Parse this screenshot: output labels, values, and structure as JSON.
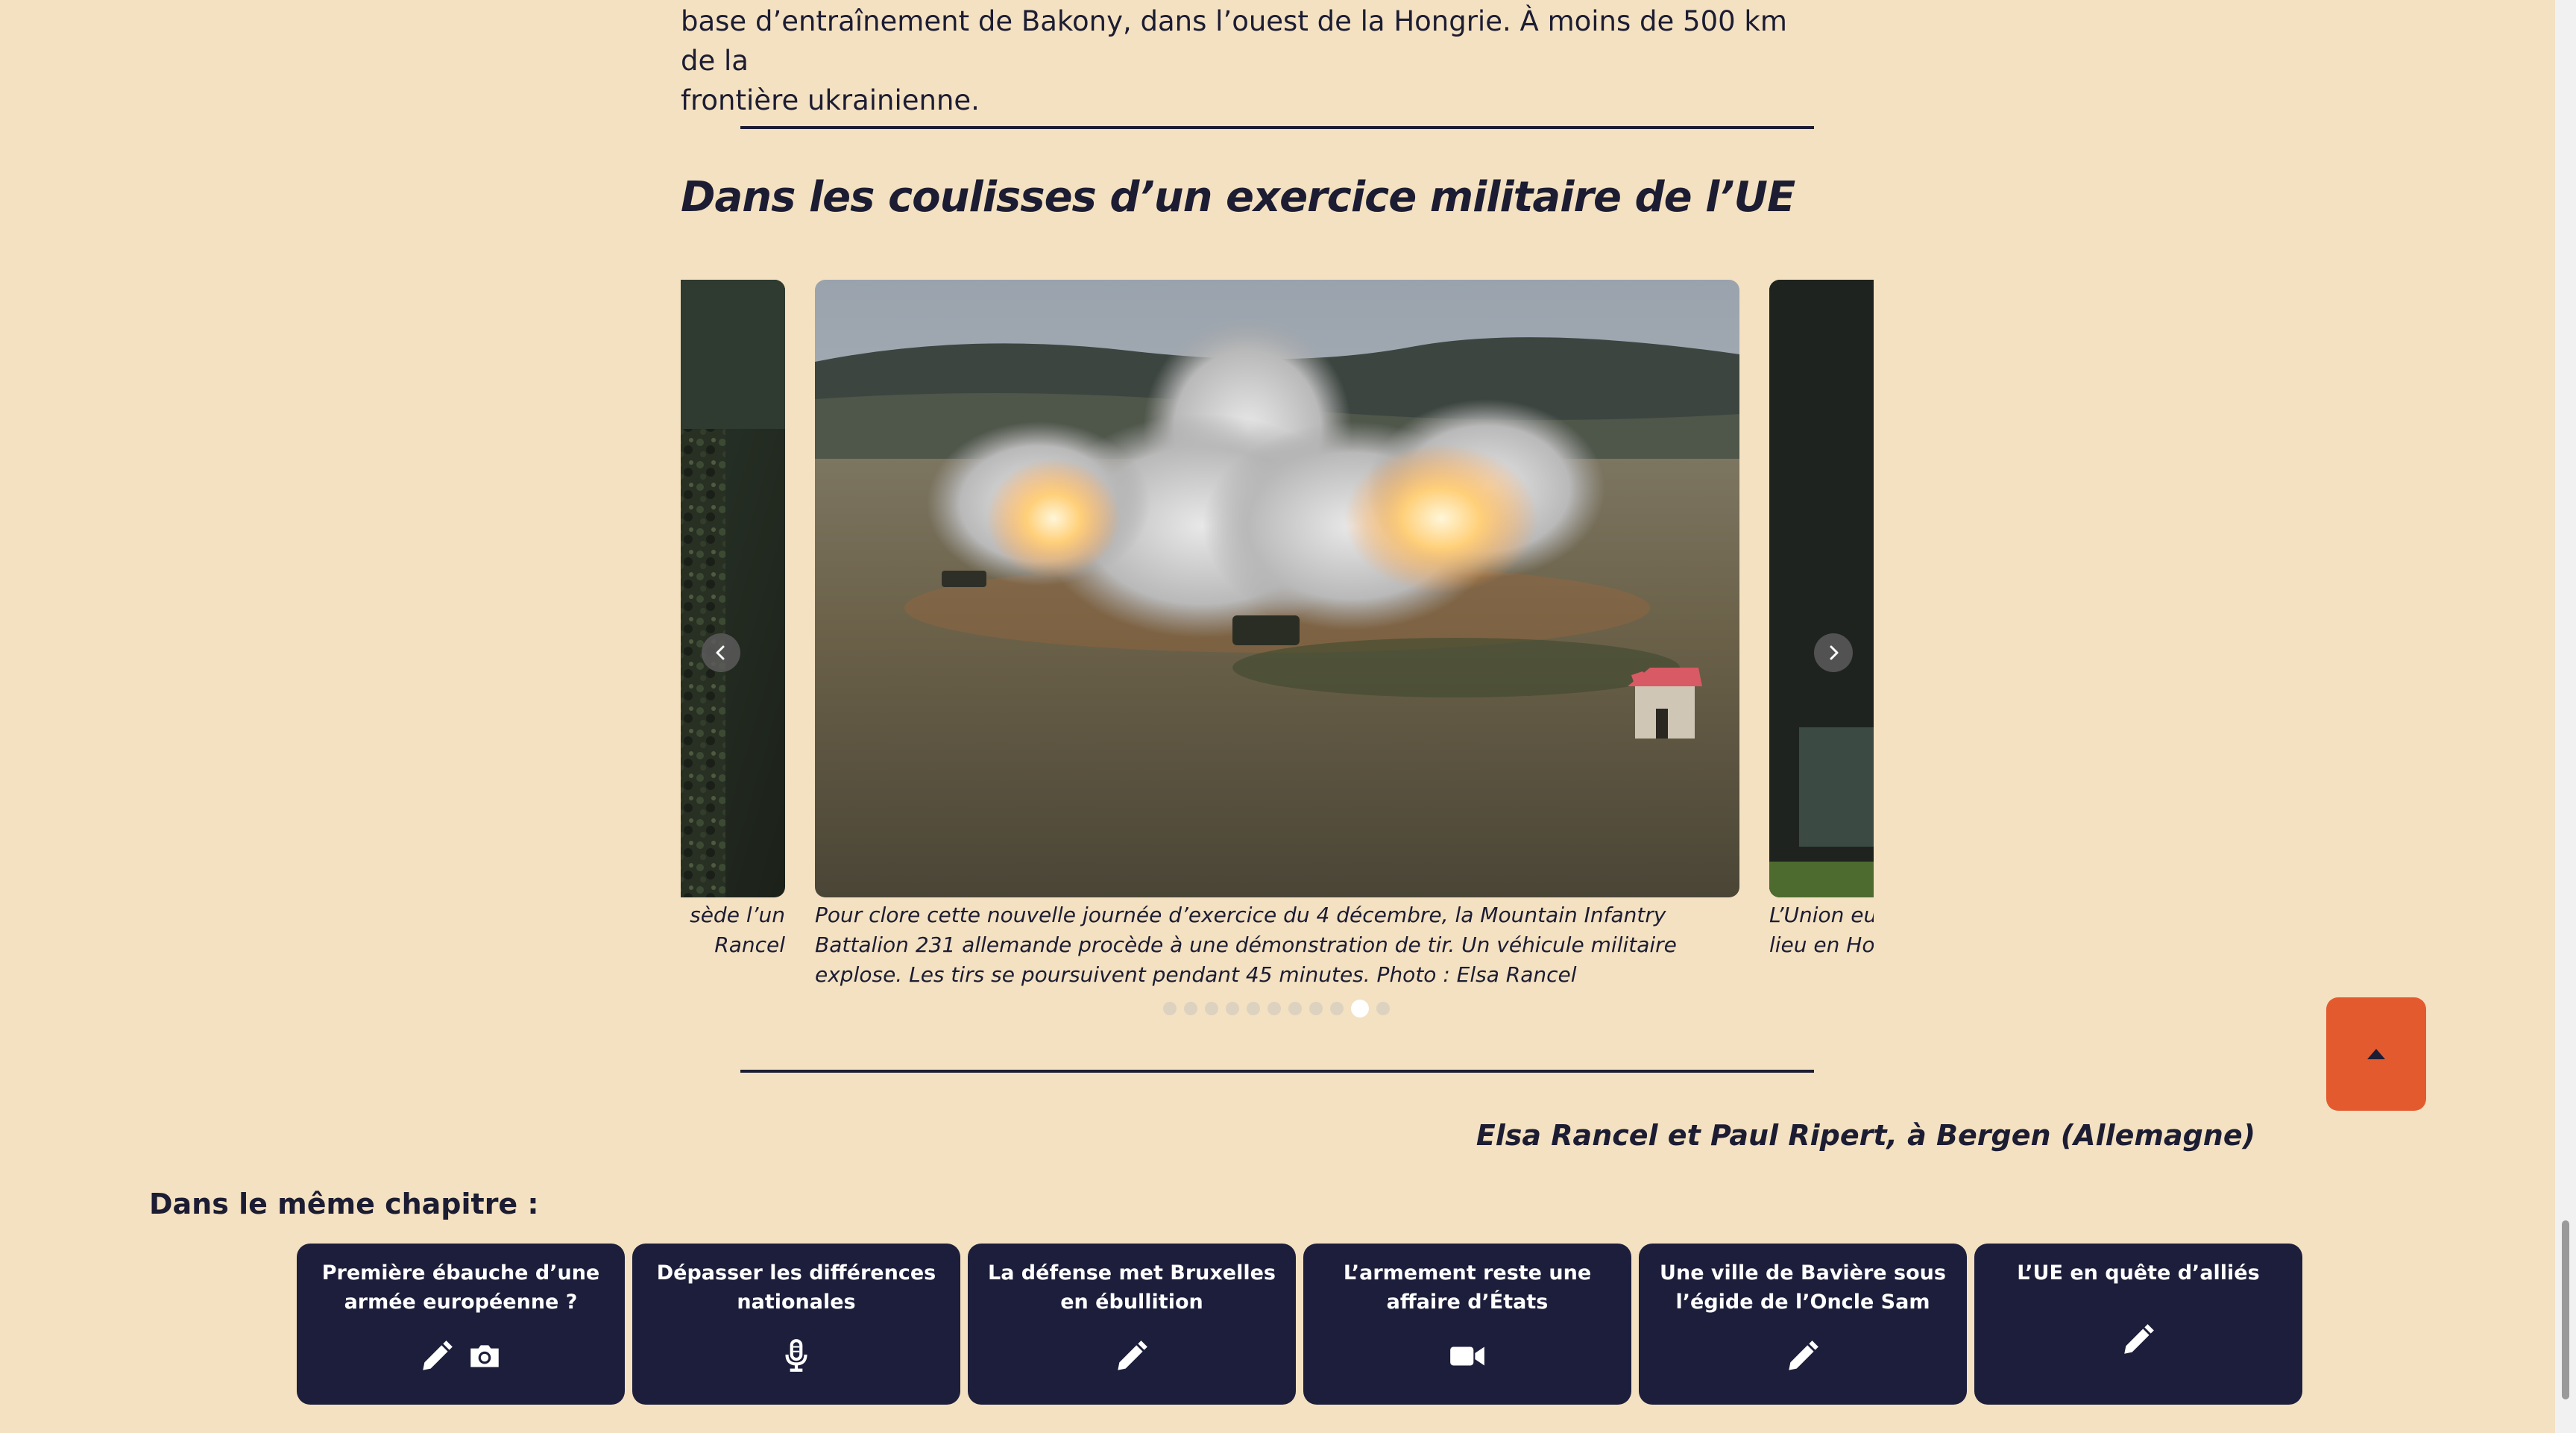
{
  "article": {
    "intro_line1": "base d’entraînement de Bakony, dans l’ouest de la Hongrie. À moins de 500 km de la",
    "intro_line2": "frontière ukrainienne.",
    "section_title": "Dans les coulisses d’un exercice militaire de l’UE",
    "byline": "Elsa Rancel et Paul Ripert, à Bergen (Allemagne)"
  },
  "carousel": {
    "prev_caption_line1": "sède l’un",
    "prev_caption_line2": "Rancel",
    "current_caption": "Pour clore cette nouvelle journée d’exercice du 4 décembre, la Mountain Infantry Battalion 231 allemande procède à une démonstration de tir. Un véhicule militaire explose. Les tirs se poursuivent pendant 45 minutes. Photo : Elsa Rancel",
    "next_caption_line1": "L’Union eur",
    "next_caption_line2": "lieu en Hon",
    "dot_count": 11,
    "active_dot": 9
  },
  "chapter": {
    "heading": "Dans le même chapitre :",
    "cards": [
      {
        "title": "Première ébauche d’une armée européenne ?",
        "icons": [
          "pencil-icon",
          "camera-icon"
        ]
      },
      {
        "title": "Dépasser les différences nationales",
        "icons": [
          "microphone-icon"
        ]
      },
      {
        "title": "La défense met Bruxelles en ébullition",
        "icons": [
          "pencil-icon"
        ]
      },
      {
        "title": "L’armement reste une affaire d’États",
        "icons": [
          "video-camera-icon"
        ]
      },
      {
        "title": "Une ville de Bavière sous l’égide de l’Oncle Sam",
        "icons": [
          "pencil-icon"
        ]
      },
      {
        "title": "L’UE en quête d’alliés",
        "icons": [
          "pencil-icon"
        ]
      }
    ]
  },
  "colors": {
    "background": "#f3e1c1",
    "text": "#1c1c33",
    "card": "#1c1e3b",
    "back_to_top": "#e45a2f"
  }
}
